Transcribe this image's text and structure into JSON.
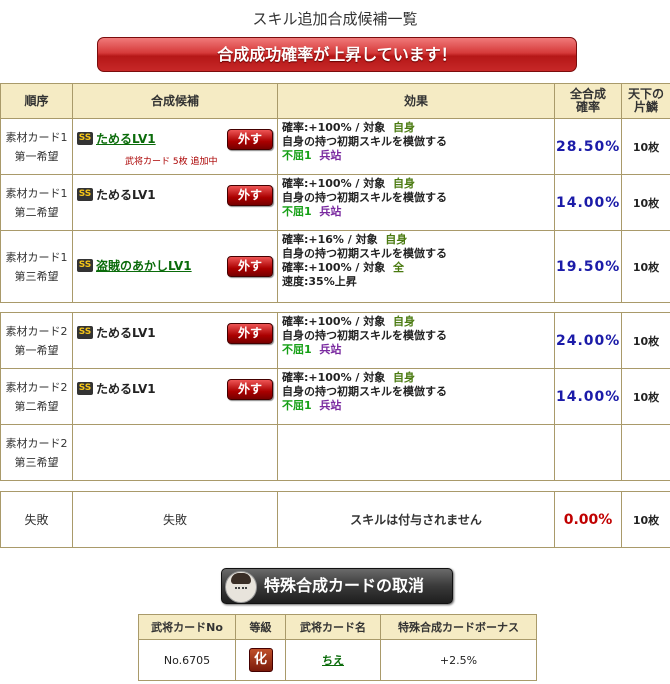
{
  "page_title": "スキル追加合成候補一覧",
  "banner": "合成成功確率が上昇しています！",
  "headers": {
    "order": "順序",
    "candidate": "合成候補",
    "effect": "効果",
    "rate_line1": "全合成",
    "rate_line2": "確率",
    "tenka_line1": "天下の",
    "tenka_line2": "片鱗"
  },
  "remove_label": "外す",
  "ss_badge": "SS",
  "group1": [
    {
      "order1": "素材カード1",
      "order2": "第一希望",
      "skill": "ためるLV1",
      "note": "武将カード 5枚 追加中",
      "effect": {
        "l1a": "確率:+100% / 対象",
        "l1b": "自身",
        "l2": "自身の持つ初期スキルを模倣する",
        "l3a": "不屈1",
        "l3b": "兵站"
      },
      "rate": "28.50%",
      "tenka": "10枚"
    },
    {
      "order1": "素材カード1",
      "order2": "第二希望",
      "skill": "ためるLV1",
      "effect": {
        "l1a": "確率:+100% / 対象",
        "l1b": "自身",
        "l2": "自身の持つ初期スキルを模倣する",
        "l3a": "不屈1",
        "l3b": "兵站"
      },
      "rate": "14.00%",
      "tenka": "10枚"
    },
    {
      "order1": "素材カード1",
      "order2": "第三希望",
      "skill": "盗賊のあかしLV1",
      "effect": {
        "l1a": "確率:+16% / 対象",
        "l1b": "自身",
        "l2": "自身の持つ初期スキルを模倣する",
        "l3a": "確率:+100% / 対象",
        "l3b": "全",
        "l4": "速度:35%上昇"
      },
      "rate": "19.50%",
      "tenka": "10枚"
    }
  ],
  "group2": [
    {
      "order1": "素材カード2",
      "order2": "第一希望",
      "skill": "ためるLV1",
      "effect": {
        "l1a": "確率:+100% / 対象",
        "l1b": "自身",
        "l2": "自身の持つ初期スキルを模倣する",
        "l3a": "不屈1",
        "l3b": "兵站"
      },
      "rate": "24.00%",
      "tenka": "10枚"
    },
    {
      "order1": "素材カード2",
      "order2": "第二希望",
      "skill": "ためるLV1",
      "effect": {
        "l1a": "確率:+100% / 対象",
        "l1b": "自身",
        "l2": "自身の持つ初期スキルを模倣する",
        "l3a": "不屈1",
        "l3b": "兵站"
      },
      "rate": "14.00%",
      "tenka": "10枚"
    },
    {
      "order1": "素材カード2",
      "order2": "第三希望"
    }
  ],
  "failure": {
    "order": "失敗",
    "candidate": "失敗",
    "effect": "スキルは付与されません",
    "rate": "0.00%",
    "tenka": "10枚"
  },
  "special_button": "特殊合成カードの取消",
  "bonus_table": {
    "headers": [
      "武将カードNo",
      "等級",
      "武将カード名",
      "特殊合成カードボーナス"
    ],
    "card_no": "No.6705",
    "rank": "化",
    "card_name": "ちえ",
    "bonus": "+2.5%"
  }
}
